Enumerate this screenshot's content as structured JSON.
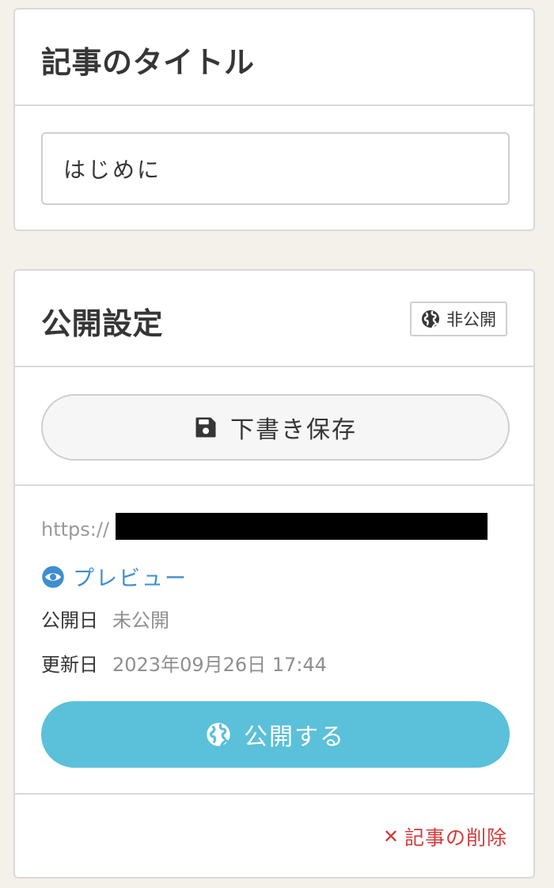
{
  "title_card": {
    "heading": "記事のタイトル",
    "title_value": "はじめに"
  },
  "publish_card": {
    "heading": "公開設定",
    "status_badge": "非公開",
    "status_icon": "globe-icon",
    "draft_button": {
      "label": "下書き保存",
      "icon": "floppy-disk-icon"
    },
    "url_prefix": "https://",
    "preview": {
      "label": "プレビュー",
      "icon": "eye-icon"
    },
    "published_date": {
      "label": "公開日",
      "value": "未公開"
    },
    "updated_date": {
      "label": "更新日",
      "value": "2023年09月26日 17:44"
    },
    "publish_button": {
      "label": "公開する",
      "icon": "globe-icon"
    },
    "delete_link": {
      "icon_glyph": "✕",
      "label": "記事の削除"
    }
  },
  "colors": {
    "background": "#f4f1ea",
    "link_blue": "#3e8ed0",
    "publish_cyan": "#5bc0d9",
    "danger_red": "#d43b3b",
    "muted_gray": "#8f8f8f"
  }
}
